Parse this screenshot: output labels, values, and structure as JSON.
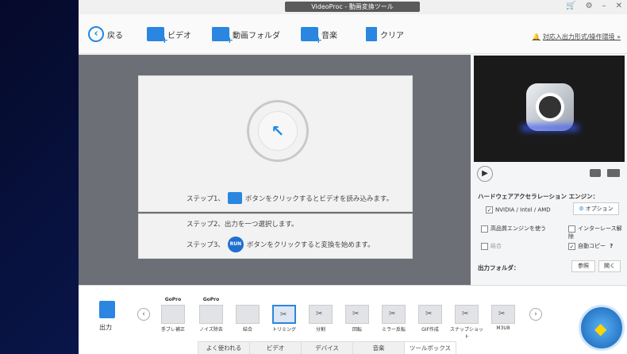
{
  "window": {
    "title": "VideoProc - 動画変換ツール"
  },
  "toolbar": {
    "back": "戻る",
    "video": "ビデオ",
    "folder": "動画フォルダ",
    "music": "音楽",
    "clear": "クリア",
    "tip": "対応入出力形式/操作環境 »"
  },
  "steps": {
    "step1_prefix": "ステップ1、",
    "step1_suffix": "ボタンをクリックするとビデオを読み込みます。",
    "step2": "ステップ2、出力を一つ選択します。",
    "step3_prefix": "ステップ3、",
    "step3_suffix": "ボタンをクリックすると変換を始めます。",
    "run_label": "RUN"
  },
  "settings": {
    "hw_title": "ハードウェアアクセラレーション エンジン：",
    "gpu": "NVIDIA / Intel / AMD",
    "option": "オプション",
    "hq_engine": "高品質エンジンを使う",
    "deinterlace": "インターレース解除",
    "merge": "結合",
    "autocopy": "自動コピー",
    "help": "?",
    "output_folder": "出力フォルダ：",
    "browse": "参照",
    "open": "開く"
  },
  "bottom": {
    "output": "出力",
    "prev": "‹",
    "next": "›",
    "tiles": [
      {
        "brand": "GoPro",
        "label": "手ブレ補正"
      },
      {
        "brand": "GoPro",
        "label": "ノイズ除去"
      },
      {
        "brand": "",
        "label": "結合"
      },
      {
        "brand": "",
        "label": "トリミング"
      },
      {
        "brand": "",
        "label": "分割"
      },
      {
        "brand": "",
        "label": "回転"
      },
      {
        "brand": "",
        "label": "ミラー反転"
      },
      {
        "brand": "",
        "label": "GIF作成"
      },
      {
        "brand": "",
        "label": "スナップショット"
      },
      {
        "brand": "",
        "label": "M3U8"
      }
    ],
    "tabs": [
      "よく使われる",
      "ビデオ",
      "デバイス",
      "音楽",
      "ツールボックス"
    ],
    "active_tab": "ツールボックス"
  }
}
